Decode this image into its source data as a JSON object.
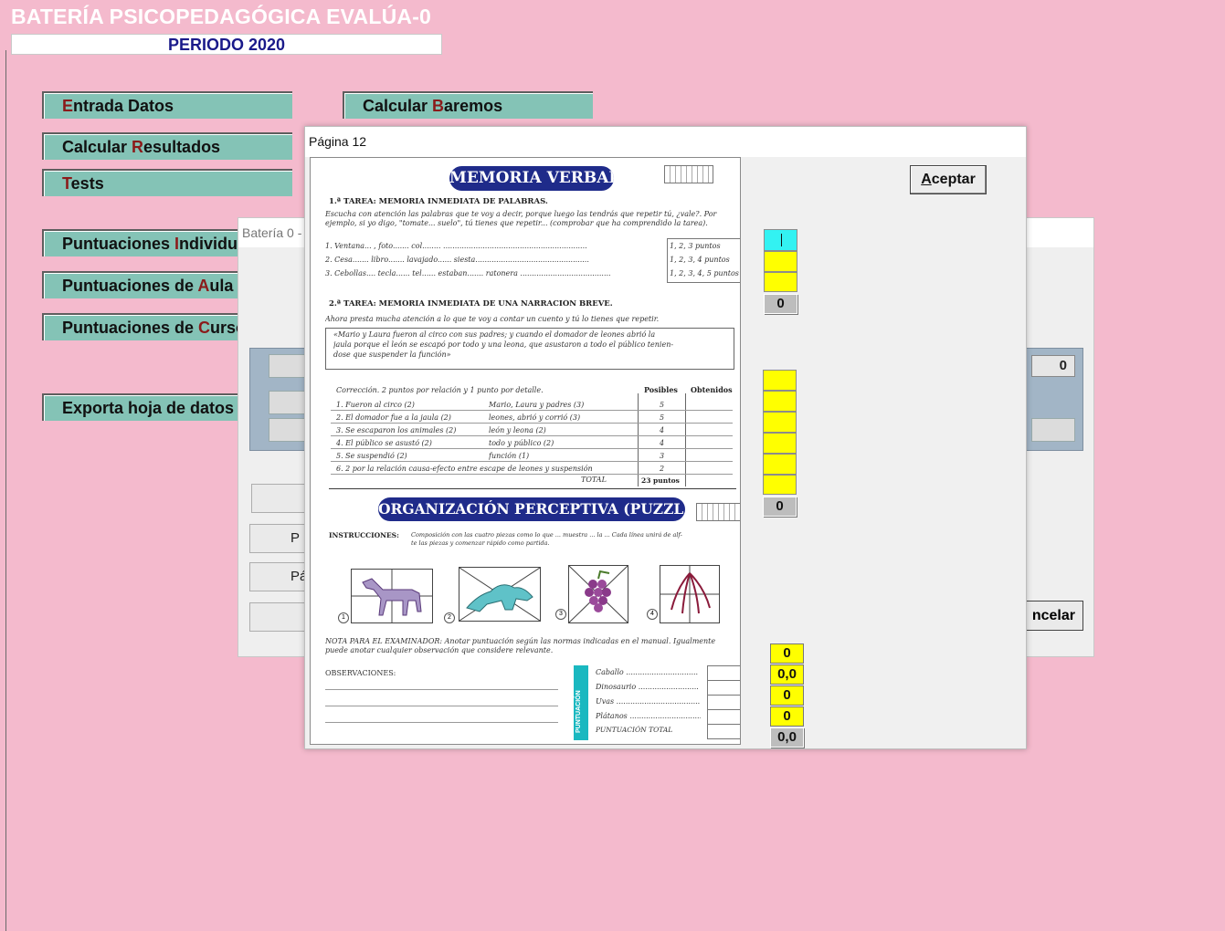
{
  "app": {
    "title": "BATERÍA PSICOPEDAGÓGICA EVALÚA-0",
    "period": "PERIODO 2020"
  },
  "menu": [
    {
      "pre": "",
      "hk": "E",
      "post": "ntrada Datos"
    },
    {
      "pre": "Calcular ",
      "hk": "B",
      "post": "aremos"
    },
    {
      "pre": "Calcular ",
      "hk": "R",
      "post": "esultados"
    },
    {
      "pre": "",
      "hk": "T",
      "post": "ests"
    },
    {
      "pre": "Puntuaciones ",
      "hk": "I",
      "post": "ndividuales"
    },
    {
      "pre": "Puntuaciones de ",
      "hk": "A",
      "post": "ula"
    },
    {
      "pre": "Puntuaciones de ",
      "hk": "C",
      "post": "urso"
    },
    {
      "pre": "Exporta hoja de datos",
      "hk": "",
      "post": ""
    }
  ],
  "background_dialog": {
    "title": "Batería 0 -",
    "value": "0",
    "btn_p1": "P",
    "btn_p2": "Pá",
    "cancel_label": "ncelar"
  },
  "modal": {
    "title": "Página 12",
    "accept_hk": "A",
    "accept_rest": "ceptar",
    "scores": {
      "mem_total": "0",
      "puzzle_total": "0",
      "final": [
        "0",
        "0,0",
        "0",
        "0",
        "0,0"
      ]
    }
  },
  "scan": {
    "banner1": "MEMORIA VERBAL",
    "t1_head": "1.ª TAREA:   MEMORIA INMEDIATA DE PALABRAS.",
    "t1_intro1": "Escucha con atención las palabras que te voy a decir, porque luego las tendrás que repetir tú, ¿vale?. Por",
    "t1_intro2": "ejemplo, si yo digo, \"tomate... suelo\", tú tienes que repetir... (comprobar que ha comprendido la tarea).",
    "t1_rows": [
      {
        "text": "1.   Ventana... , foto....... col........ ..............................................................",
        "score": "1, 2, 3 puntos"
      },
      {
        "text": "2.   Cesa....... libro....... lavajado...... siesta.................................................",
        "score": "1, 2, 3, 4 puntos"
      },
      {
        "text": "3.   Cebollas.... tecla...... tel...... estaban....... ratonera .......................................",
        "score": "1, 2, 3, 4, 5 puntos"
      }
    ],
    "t2_head": "2.ª TAREA:   MEMORIA INMEDIATA DE UNA NARRACIÓN BREVE.",
    "t2_intro": "Ahora presta mucha atención a lo que te voy a contar un cuento y tú lo tienes que repetir.",
    "story1": "«Mario y Laura fueron al circo con sus padres; y cuando el domador de leones abrió la",
    "story2": "jaula porque el león se escapó por todo y una leona, que asustaron a todo el público tenien-",
    "story3": "dose que suspender la función»",
    "corr": "Corrección. 2 puntos por relación y 1 punto por detalle.",
    "col_pos": "Posibles",
    "col_obt": "Obtenidos",
    "t2_rows": [
      {
        "a": "1.  Fueron al circo (2)",
        "b": "Mario, Laura y padres (3)",
        "p": "5"
      },
      {
        "a": "2.  El domador fue a la jaula (2)",
        "b": "leones, abrió y corrió (3)",
        "p": "5"
      },
      {
        "a": "3.  Se escaparon los animales (2)",
        "b": "león y leona (2)",
        "p": "4"
      },
      {
        "a": "4.  El público se asustó (2)",
        "b": "todo y público (2)",
        "p": "4"
      },
      {
        "a": "5.  Se suspendió (2)",
        "b": "función (1)",
        "p": "3"
      },
      {
        "a": "6.  2 por la relación causa-efecto entre escape de leones y suspensión",
        "b": "",
        "p": "2"
      }
    ],
    "total_label": "TOTAL",
    "total_value": "23 puntos",
    "banner2": "ORGANIZACIÓN PERCEPTIVA (PUZZLES)",
    "instr_label": "INSTRUCCIONES:",
    "instr_text1": "Composición con las cuatro piezas como lo que ... muestra ... la ... Cada línea unirá de alf-",
    "instr_text2": "te las piezas y comenzar rápido como partida.",
    "pics": [
      "1",
      "2",
      "3",
      "4"
    ],
    "note1": "NOTA PARA EL EXAMINADOR: Anotar puntuación según las normas indicadas en el manual. Igualmente",
    "note2": "puede anotar cualquier observación que considere relevante.",
    "obs_label": "OBSERVACIONES:",
    "side_label": "PUNTUACIÓN",
    "puzzle_items": [
      "Caballo ...............................",
      "Dinosaurio ..........................",
      "Uvas ......................................",
      "Plátanos .................................",
      "PUNTUACIÓN TOTAL"
    ]
  }
}
